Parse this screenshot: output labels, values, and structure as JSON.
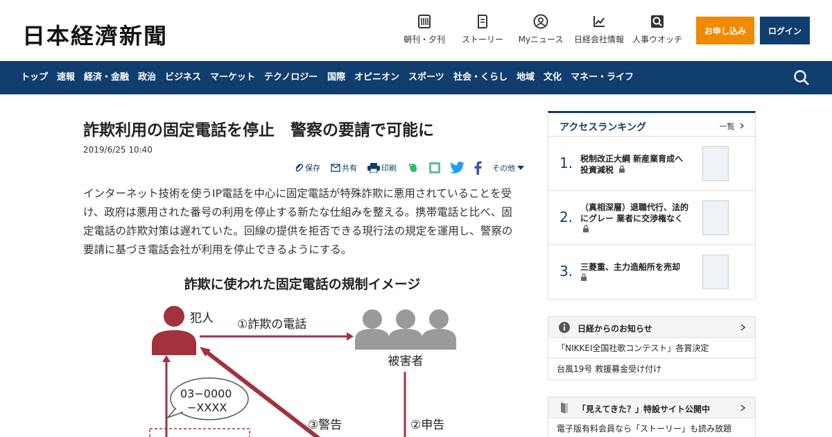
{
  "header": {
    "logo": "日本経濟新聞",
    "nav": [
      {
        "label": "朝刊・夕刊",
        "icon": "newspaper-icon"
      },
      {
        "label": "ストーリー",
        "icon": "book-icon"
      },
      {
        "label": "Myニュース",
        "icon": "user-icon"
      },
      {
        "label": "日経会社情報",
        "icon": "chart-icon"
      },
      {
        "label": "人事ウオッチ",
        "icon": "search-person-icon"
      }
    ],
    "apply_label": "お申し込み",
    "login_label": "ログイン",
    "accent": "#f08a00",
    "brand": "#0f3e6e"
  },
  "navbar": {
    "items": [
      "トップ",
      "速報",
      "経済・金融",
      "政治",
      "ビジネス",
      "マーケット",
      "テクノロジー",
      "国際",
      "オピニオン",
      "スポーツ",
      "社会・くらし",
      "地域",
      "文化",
      "マネー・ライフ"
    ]
  },
  "article": {
    "title": "詐欺利用の固定電話を停止　警察の要請で可能に",
    "date": "2019/6/25 10:40",
    "share": {
      "save": "保存",
      "share": "共有",
      "print": "印刷",
      "other": "その他"
    },
    "body": "インターネット技術を使うIP電話を中心に固定電話が特殊詐欺に悪用されていることを受け、政府は悪用された番号の利用を停止する新たな仕組みを整える。携帯電話と比べ、固定電話の詐欺対策は遅れていた。回線の提供を拒否できる現行法の規定を運用し、警察の要請に基づき電話会社が利用を停止できるようにする。"
  },
  "figure": {
    "title": "詐欺に使われた固定電話の規制イメージ",
    "criminal": "犯人",
    "victims": "被害者",
    "arrow1": "①詐欺の電話",
    "arrow2": "②申告",
    "arrow3": "③警告",
    "phone_line1": "03−0000",
    "phone_line2": "−XXXX",
    "criminal_color": "#a3313e",
    "victim_color": "#9a9a9a"
  },
  "sidebar": {
    "ranking": {
      "title": "アクセスランキング",
      "more": "一覧",
      "items": [
        {
          "num": "1.",
          "text": "税制改正大綱 新産業育成へ投資減税"
        },
        {
          "num": "2.",
          "text": "（真相深層）退職代行、法的にグレー 業者に交渉権なく"
        },
        {
          "num": "3.",
          "text": "三菱重、主力造船所を売却"
        }
      ]
    },
    "notice": {
      "title": "日経からのお知らせ",
      "rows": [
        "「NIKKEI全国社歌コンテスト」各賞決定",
        "台風19号 救援募金受け付け"
      ]
    },
    "promo": {
      "title": "「見えてきた？」特設サイト公開中",
      "rows": [
        "電子版有料会員なら「ストーリー」も読み放題"
      ]
    }
  }
}
